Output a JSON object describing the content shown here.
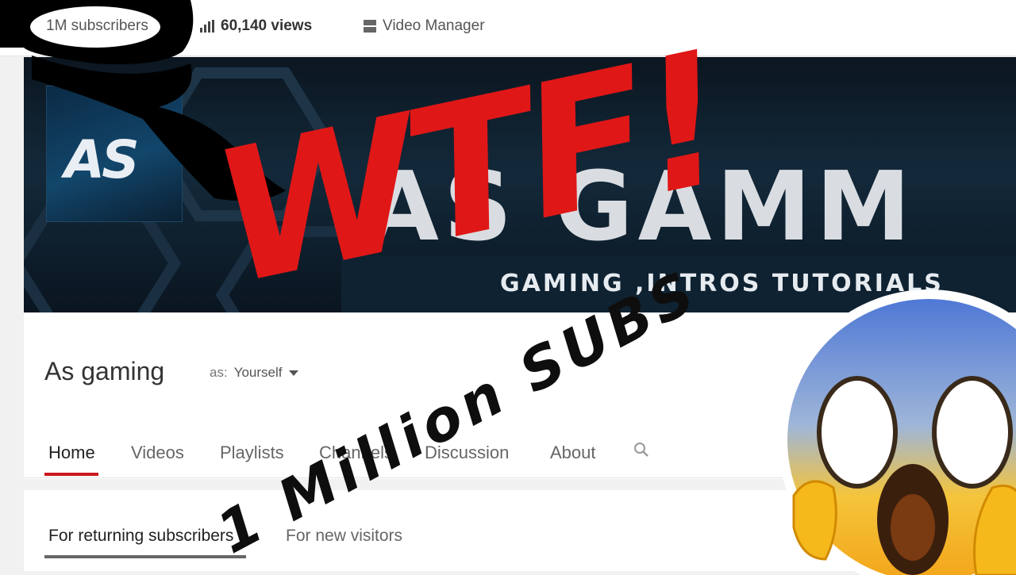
{
  "topbar": {
    "subscribers": "1M subscribers",
    "views": "60,140 views",
    "video_manager": "Video Manager"
  },
  "banner": {
    "logo_text": "AS",
    "title": "AS GAMM",
    "subtitle": "GAMING ,INTROS TUTORIALS"
  },
  "channel": {
    "name": "As gaming",
    "view_as_label": "as:",
    "view_as_value": "Yourself"
  },
  "tabs": [
    {
      "label": "Home"
    },
    {
      "label": "Videos"
    },
    {
      "label": "Playlists"
    },
    {
      "label": "Channels"
    },
    {
      "label": "Discussion"
    },
    {
      "label": "About"
    }
  ],
  "sub_tabs": [
    {
      "label": "For returning subscribers"
    },
    {
      "label": "For new visitors"
    }
  ],
  "overlay": {
    "headline": "WTF!",
    "caption": "1 Million SUBS"
  },
  "colors": {
    "accent_red": "#cc181e",
    "headline_red": "#e01717"
  },
  "icons": [
    "bar-chart-icon",
    "video-manager-icon",
    "search-icon",
    "caret-down-icon",
    "screaming-face-emoji"
  ]
}
